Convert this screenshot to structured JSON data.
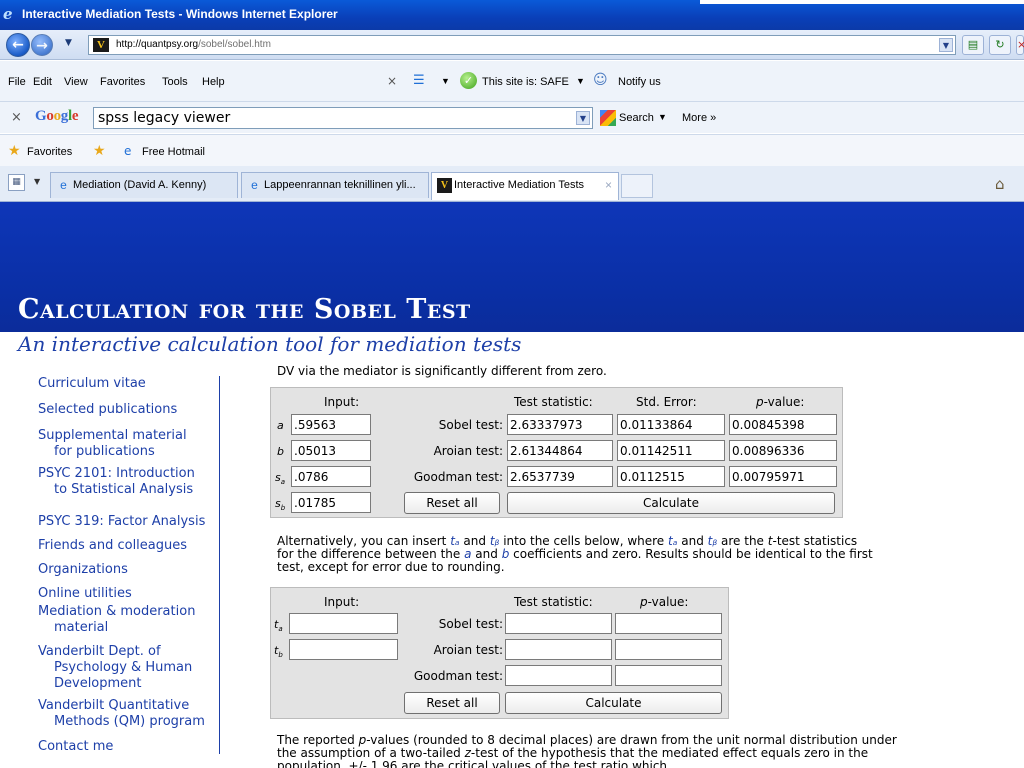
{
  "window": {
    "title": "Interactive Mediation Tests - Windows Internet Explorer"
  },
  "address": {
    "url_host": "http://quantpsy.org",
    "url_path": "/sobel/sobel.htm"
  },
  "menu": [
    "File",
    "Edit",
    "View",
    "Favorites",
    "Tools",
    "Help"
  ],
  "toolbar": {
    "safe_text": "This site is: SAFE",
    "notify": "Notify us"
  },
  "google": {
    "logo": "Google",
    "query": "spss legacy viewer",
    "search_label": "Search",
    "more_label": "More »"
  },
  "favorites": {
    "label": "Favorites",
    "free_hotmail": "Free Hotmail"
  },
  "tabs": [
    {
      "label": "Mediation (David A. Kenny)"
    },
    {
      "label": "Lappeenrannan teknillinen yli..."
    },
    {
      "label": "Interactive Mediation Tests"
    }
  ],
  "page": {
    "title": "Calculation for the Sobel Test",
    "subtitle": "An interactive calculation tool for mediation tests",
    "intro_fragment": "DV via the mediator is significantly different from zero."
  },
  "sidebar": {
    "items": [
      [
        "Curriculum vitae"
      ],
      [
        "Selected publications"
      ],
      [
        "Supplemental material",
        "for publications"
      ],
      [
        "PSYC 2101: Introduction",
        "to Statistical Analysis"
      ],
      [
        "PSYC 319: Factor Analysis"
      ],
      [
        "Friends and colleagues"
      ],
      [
        "Organizations"
      ],
      [
        "Online utilities"
      ],
      [
        "Mediation & moderation",
        "material"
      ],
      [
        "Vanderbilt Dept. of",
        "Psychology & Human",
        "Development"
      ],
      [
        "Vanderbilt Quantitative",
        "Methods (QM) program"
      ],
      [
        "Contact me"
      ]
    ]
  },
  "calc1": {
    "headers": {
      "input": "Input:",
      "stat": "Test statistic:",
      "se": "Std. Error:",
      "p_prefix": "p",
      "p_suffix": "-value:"
    },
    "rows": [
      {
        "var": "a",
        "input": ".59563",
        "test": "Sobel test:",
        "stat": "2.63337973",
        "se": "0.01133864",
        "p": "0.00845398"
      },
      {
        "var": "b",
        "input": ".05013",
        "test": "Aroian test:",
        "stat": "2.61344864",
        "se": "0.01142511",
        "p": "0.00896336"
      },
      {
        "var": "sa",
        "input": ".0786",
        "test": "Goodman test:",
        "stat": "2.6537739",
        "se": "0.0112515",
        "p": "0.00795971"
      },
      {
        "var": "sb",
        "input": ".01785"
      }
    ],
    "reset_label": "Reset all",
    "calc_label": "Calculate"
  },
  "para1": {
    "line1_a": "Alternatively, you can insert",
    "ta": "tₐ",
    "and": "and",
    "tb": "tᵦ",
    "line1_b": "into the cells below, where",
    "line1_c": "are the",
    "t": "t",
    "line1_d": "-test",
    "line2": "statistics for the difference between the",
    "a": "a",
    "b": "b",
    "line2_b": "coefficients and zero. Results should be",
    "line3": "identical to the first test, except for error due to rounding."
  },
  "calc2": {
    "headers": {
      "input": "Input:",
      "stat": "Test statistic:",
      "p_prefix": "p",
      "p_suffix": "-value:"
    },
    "rows": [
      {
        "var": "ta",
        "test": "Sobel test:"
      },
      {
        "var": "tb",
        "test": "Aroian test:"
      },
      {
        "test": "Goodman test:"
      }
    ],
    "reset_label": "Reset all",
    "calc_label": "Calculate"
  },
  "para2": {
    "line1_a": "The reported",
    "p": "p",
    "line1_b": "-values (rounded to 8 decimal places) are drawn from the unit normal",
    "line2_a": "distribution under the assumption of a two-tailed",
    "z": "z",
    "line2_b": "-test of the hypothesis that the mediated",
    "line3": "effect equals zero in the population. +/- 1.96 are the critical values of the test ratio which"
  }
}
